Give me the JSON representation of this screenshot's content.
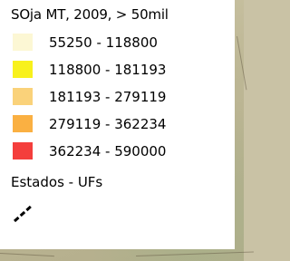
{
  "legend": {
    "title": "SOja MT, 2009, > 50mil",
    "classes": [
      {
        "range": "55250 - 118800",
        "color": "#fcf7d4"
      },
      {
        "range": "118800 - 181193",
        "color": "#f8f11c"
      },
      {
        "range": "181193 - 279119",
        "color": "#fad27a"
      },
      {
        "range": "279119 - 362234",
        "color": "#fab042"
      },
      {
        "range": "362234 - 590000",
        "color": "#f43e3c"
      }
    ],
    "boundary_layer": {
      "label": "Estados - UFs",
      "symbol_color": "#000000"
    }
  },
  "map": {
    "background_color": "#c9c2a5",
    "state_highlight_color": "#e8d800"
  }
}
